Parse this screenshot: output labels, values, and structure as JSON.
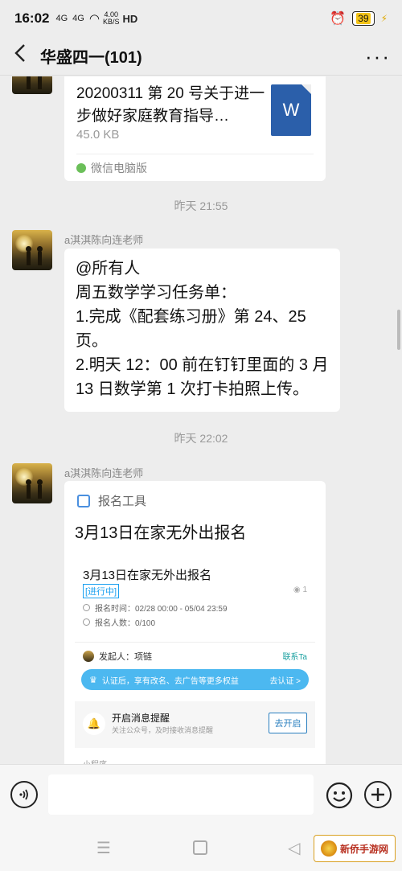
{
  "status_bar": {
    "time": "16:02",
    "signal1": "4G",
    "signal2": "4G",
    "net_speed": "4.00",
    "net_unit": "KB/S",
    "hd": "HD",
    "battery": "39"
  },
  "header": {
    "title": "华盛四一(101)",
    "more": "···"
  },
  "messages": {
    "file": {
      "name": "20200311 第 20 号关于进一步做好家庭教育指导…",
      "size": "45.0 KB",
      "icon_letter": "W",
      "source": "微信电脑版"
    },
    "ts1": "昨天 21:55",
    "sender1": "a淇淇陈向连老师",
    "text1": {
      "l1": "@所有人",
      "l2": "周五数学学习任务单：",
      "l3": "1.完成《配套练习册》第 24、25",
      "l4": "页。",
      "l5": "2.明天 12：00 前在钉钉里面的 3 月",
      "l6": "13 日数学第 1 次打卡拍照上传。"
    },
    "ts2": "昨天 22:02",
    "sender2": "a淇淇陈向连老师",
    "card": {
      "app_name": "报名工具",
      "title": "3月13日在家无外出报名",
      "inner_title": "3月13日在家无外出报名",
      "status": "[进行中]",
      "views": "1",
      "time_row": "报名时间：02/28 00:00 - 05/04 23:59",
      "count_row": "报名人数：0/100",
      "initiator": "发起人：项链",
      "contact": "联系Ta",
      "banner_text": "认证后，享有改名、去广告等更多权益",
      "banner_go": "去认证 >",
      "remind_title": "开启消息提醒",
      "remind_sub": "关注公众号，及时接收消息提醒",
      "remind_btn": "去开启",
      "cut_text": "小程序"
    }
  },
  "input_bar": {
    "placeholder": ""
  },
  "watermark": "新侨手游网"
}
